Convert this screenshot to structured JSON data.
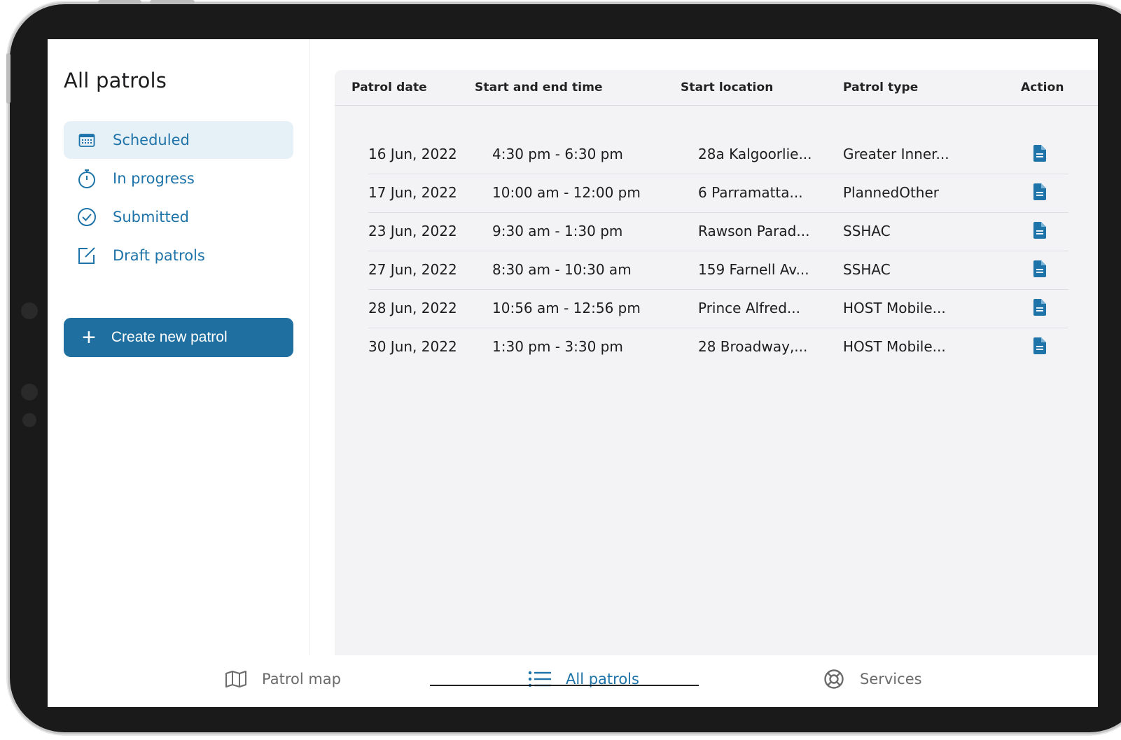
{
  "sidebar": {
    "title": "All patrols",
    "items": [
      {
        "label": "Scheduled",
        "icon": "calendar-icon",
        "active": true
      },
      {
        "label": "In progress",
        "icon": "stopwatch-icon",
        "active": false
      },
      {
        "label": "Submitted",
        "icon": "check-circle-icon",
        "active": false
      },
      {
        "label": "Draft patrols",
        "icon": "edit-icon",
        "active": false
      }
    ],
    "create_label": "Create new patrol"
  },
  "table": {
    "headers": {
      "date": "Patrol date",
      "time": "Start and end time",
      "location": "Start location",
      "type": "Patrol type",
      "action": "Action"
    },
    "rows": [
      {
        "date": "16 Jun, 2022",
        "time": "4:30 pm - 6:30 pm",
        "location": "28a Kalgoorlie...",
        "type": "Greater Inner..."
      },
      {
        "date": "17 Jun, 2022",
        "time": "10:00 am - 12:00 pm",
        "location": "6 Parramatta...",
        "type": "PlannedOther"
      },
      {
        "date": "23 Jun, 2022",
        "time": "9:30 am - 1:30 pm",
        "location": "Rawson Parad...",
        "type": "SSHAC"
      },
      {
        "date": "27 Jun, 2022",
        "time": "8:30 am - 10:30 am",
        "location": "159 Farnell Av...",
        "type": "SSHAC"
      },
      {
        "date": "28 Jun, 2022",
        "time": "10:56 am - 12:56 pm",
        "location": "Prince Alfred...",
        "type": "HOST Mobile..."
      },
      {
        "date": "30 Jun, 2022",
        "time": "1:30 pm - 3:30 pm",
        "location": "28 Broadway,...",
        "type": "HOST Mobile..."
      }
    ]
  },
  "bottom_nav": {
    "tabs": [
      {
        "label": "Patrol map",
        "icon": "map-icon",
        "active": false
      },
      {
        "label": "All patrols",
        "icon": "list-icon",
        "active": true
      },
      {
        "label": "Services",
        "icon": "lifebuoy-icon",
        "active": false
      }
    ]
  },
  "colors": {
    "accent": "#1e73a8",
    "button": "#1f6fa0",
    "active_bg": "#e6f0f7",
    "content_bg": "#f3f3f5"
  }
}
